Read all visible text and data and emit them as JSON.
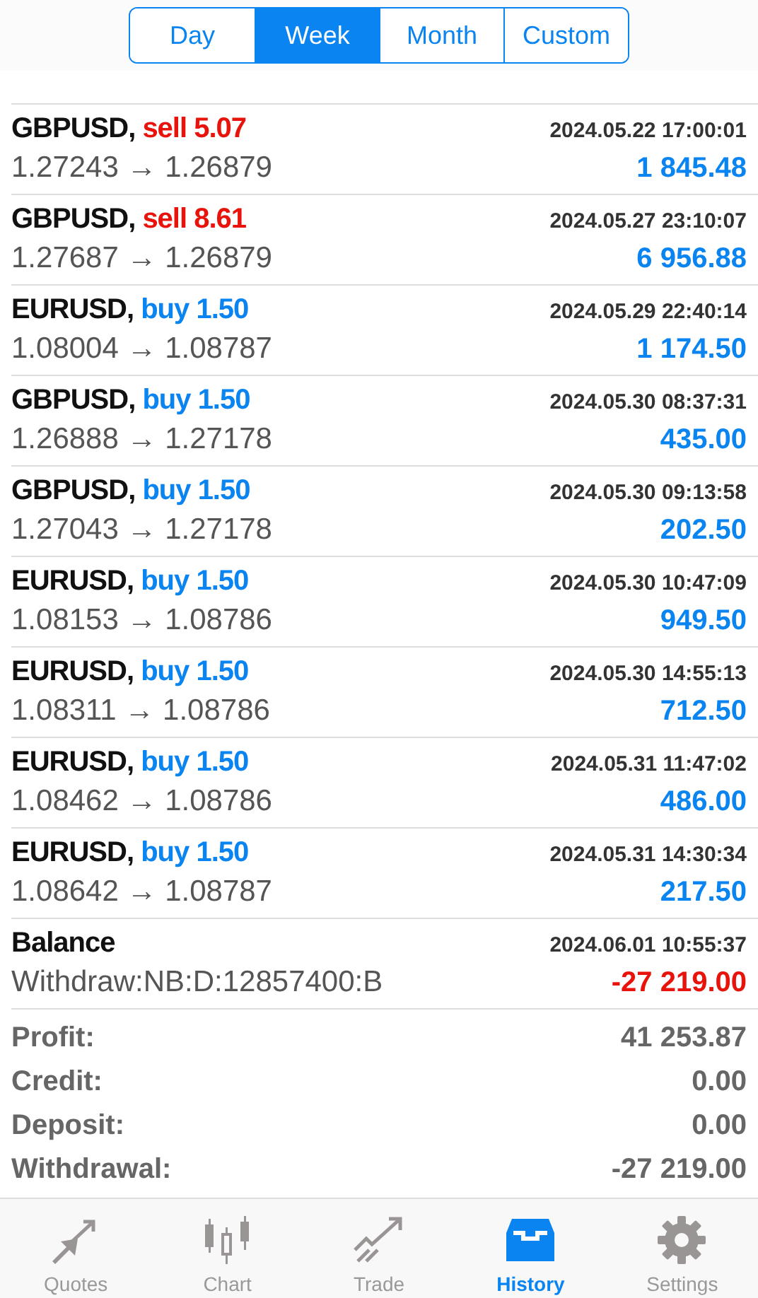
{
  "periods": [
    {
      "label": "Day",
      "selected": false
    },
    {
      "label": "Week",
      "selected": true
    },
    {
      "label": "Month",
      "selected": false
    },
    {
      "label": "Custom",
      "selected": false
    }
  ],
  "deals": [
    {
      "kind": "trade",
      "symbol": "GBPUSD,",
      "side": "sell",
      "volume": "5.07",
      "time": "2024.05.22 17:00:01",
      "prices": "1.27243 → 1.26879",
      "amount": "1 845.48",
      "negative": false
    },
    {
      "kind": "trade",
      "symbol": "GBPUSD,",
      "side": "sell",
      "volume": "8.61",
      "time": "2024.05.27 23:10:07",
      "prices": "1.27687 → 1.26879",
      "amount": "6 956.88",
      "negative": false
    },
    {
      "kind": "trade",
      "symbol": "EURUSD,",
      "side": "buy",
      "volume": "1.50",
      "time": "2024.05.29 22:40:14",
      "prices": "1.08004 → 1.08787",
      "amount": "1 174.50",
      "negative": false
    },
    {
      "kind": "trade",
      "symbol": "GBPUSD,",
      "side": "buy",
      "volume": "1.50",
      "time": "2024.05.30 08:37:31",
      "prices": "1.26888 → 1.27178",
      "amount": "435.00",
      "negative": false
    },
    {
      "kind": "trade",
      "symbol": "GBPUSD,",
      "side": "buy",
      "volume": "1.50",
      "time": "2024.05.30 09:13:58",
      "prices": "1.27043 → 1.27178",
      "amount": "202.50",
      "negative": false
    },
    {
      "kind": "trade",
      "symbol": "EURUSD,",
      "side": "buy",
      "volume": "1.50",
      "time": "2024.05.30 10:47:09",
      "prices": "1.08153 → 1.08786",
      "amount": "949.50",
      "negative": false
    },
    {
      "kind": "trade",
      "symbol": "EURUSD,",
      "side": "buy",
      "volume": "1.50",
      "time": "2024.05.30 14:55:13",
      "prices": "1.08311 → 1.08786",
      "amount": "712.50",
      "negative": false
    },
    {
      "kind": "trade",
      "symbol": "EURUSD,",
      "side": "buy",
      "volume": "1.50",
      "time": "2024.05.31 11:47:02",
      "prices": "1.08462 → 1.08786",
      "amount": "486.00",
      "negative": false
    },
    {
      "kind": "trade",
      "symbol": "EURUSD,",
      "side": "buy",
      "volume": "1.50",
      "time": "2024.05.31 14:30:34",
      "prices": "1.08642 → 1.08787",
      "amount": "217.50",
      "negative": false
    },
    {
      "kind": "balance",
      "symbol": "Balance",
      "time": "2024.06.01 10:55:37",
      "prices": "Withdraw:NB:D:12857400:B",
      "amount": "-27 219.00",
      "negative": true
    }
  ],
  "summary": [
    {
      "label": "Profit:",
      "value": "41 253.87"
    },
    {
      "label": "Credit:",
      "value": "0.00"
    },
    {
      "label": "Deposit:",
      "value": "0.00"
    },
    {
      "label": "Withdrawal:",
      "value": "-27 219.00"
    }
  ],
  "tabs": [
    {
      "label": "Quotes",
      "selected": false
    },
    {
      "label": "Chart",
      "selected": false
    },
    {
      "label": "Trade",
      "selected": false
    },
    {
      "label": "History",
      "selected": true
    },
    {
      "label": "Settings",
      "selected": false
    }
  ]
}
